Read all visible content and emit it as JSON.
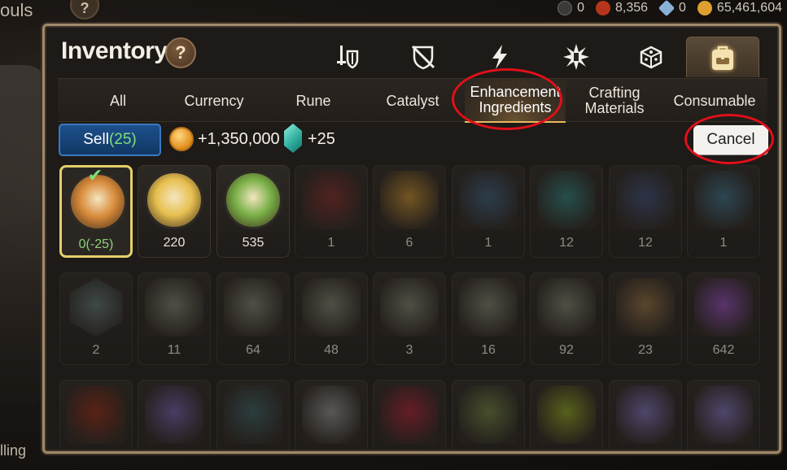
{
  "background": {
    "top_left_text": "ouls",
    "top_left_help": "?",
    "bottom_left_text": "lling"
  },
  "topbar": [
    {
      "icon": "black-orb-icon",
      "color": "#3a3a3a",
      "value": "0"
    },
    {
      "icon": "red-gear-icon",
      "color": "#b8351c",
      "value": "8,356"
    },
    {
      "icon": "blue-crystal-icon",
      "color": "#8ab0d8",
      "value": "0"
    },
    {
      "icon": "gold-coin-icon",
      "color": "#e0a030",
      "value": "65,461,604"
    }
  ],
  "panel": {
    "title": "Inventory",
    "help": "?"
  },
  "category_tabs": [
    {
      "icon": "weapon-icon",
      "active": false
    },
    {
      "icon": "accessory-icon",
      "active": false
    },
    {
      "icon": "lightning-icon",
      "active": false
    },
    {
      "icon": "shard-icon",
      "active": false
    },
    {
      "icon": "dice-icon",
      "active": false
    },
    {
      "icon": "backpack-icon",
      "active": true
    }
  ],
  "subtabs": [
    {
      "label": "All",
      "active": false
    },
    {
      "label": "Currency",
      "active": false
    },
    {
      "label": "Rune",
      "active": false
    },
    {
      "label": "Catalyst",
      "active": false
    },
    {
      "label": "Enhancement Ingredients",
      "active": true
    },
    {
      "label": "Crafting Materials",
      "active": false
    },
    {
      "label": "Consumable",
      "active": false
    }
  ],
  "sell": {
    "label": "Sell",
    "count": "(25)",
    "gold_gain": "+1,350,000",
    "gem_gain": "+25"
  },
  "cancel_label": "Cancel",
  "items": [
    {
      "count": "0(-25)",
      "kind": "phantasma-hero",
      "selected": true
    },
    {
      "count": "220",
      "kind": "phantasma-yellow"
    },
    {
      "count": "535",
      "kind": "phantasma-green"
    },
    {
      "count": "1",
      "kind": "rune-red-tablet"
    },
    {
      "count": "6",
      "kind": "rune-gold-tablet"
    },
    {
      "count": "1",
      "kind": "rune-blue-tablet"
    },
    {
      "count": "12",
      "kind": "rune-teal-tablet"
    },
    {
      "count": "12",
      "kind": "rune-purple-tablet"
    },
    {
      "count": "1",
      "kind": "rune-cyan-tablet"
    },
    {
      "count": "2",
      "kind": "rune-gem-hex"
    },
    {
      "count": "11",
      "kind": "rune-stone-green"
    },
    {
      "count": "64",
      "kind": "rune-stone-ring"
    },
    {
      "count": "48",
      "kind": "rune-stone-blue"
    },
    {
      "count": "3",
      "kind": "rune-stone-cyan"
    },
    {
      "count": "16",
      "kind": "rune-stone-teal"
    },
    {
      "count": "92",
      "kind": "rune-stone-aqua"
    },
    {
      "count": "23",
      "kind": "rune-stone-orange"
    },
    {
      "count": "642",
      "kind": "purple-crystal"
    },
    {
      "count": "",
      "kind": "red-ore"
    },
    {
      "count": "",
      "kind": "purple-orb"
    },
    {
      "count": "",
      "kind": "dark-shard"
    },
    {
      "count": "",
      "kind": "white-feather"
    },
    {
      "count": "",
      "kind": "red-crystal"
    },
    {
      "count": "",
      "kind": "gold-fish"
    },
    {
      "count": "",
      "kind": "green-ring"
    },
    {
      "count": "",
      "kind": "pet-food"
    },
    {
      "count": "",
      "kind": "pet-food-2"
    }
  ],
  "item_colors": {
    "phantasma-hero": "#d88a3a",
    "phantasma-yellow": "#e8c050",
    "phantasma-green": "#7ab048",
    "rune-red-tablet": "#7a2a28",
    "rune-gold-tablet": "#b8862c",
    "rune-blue-tablet": "#3a5a78",
    "rune-teal-tablet": "#2e7a78",
    "rune-purple-tablet": "#3a4a70",
    "rune-cyan-tablet": "#3a6a82",
    "rune-gem-hex": "#5a7070",
    "rune-stone-green": "#7a7a6a",
    "rune-stone-ring": "#7a7a6a",
    "rune-stone-blue": "#7a7a6a",
    "rune-stone-cyan": "#7a7a6a",
    "rune-stone-teal": "#7a7a6a",
    "rune-stone-aqua": "#7a7a6a",
    "rune-stone-orange": "#8a6a40",
    "purple-crystal": "#8a4ab0",
    "red-ore": "#8a2a14",
    "purple-orb": "#6a5aa0",
    "dark-shard": "#3a5a60",
    "white-feather": "#8a8a8a",
    "red-crystal": "#a02030",
    "gold-fish": "#6a7a40",
    "green-ring": "#8a9a20",
    "pet-food": "#7a6ab0",
    "pet-food-2": "#7a6ab0"
  },
  "annotations": [
    {
      "target": "subtab-enhancement-ingredients"
    },
    {
      "target": "cancel-button"
    }
  ]
}
